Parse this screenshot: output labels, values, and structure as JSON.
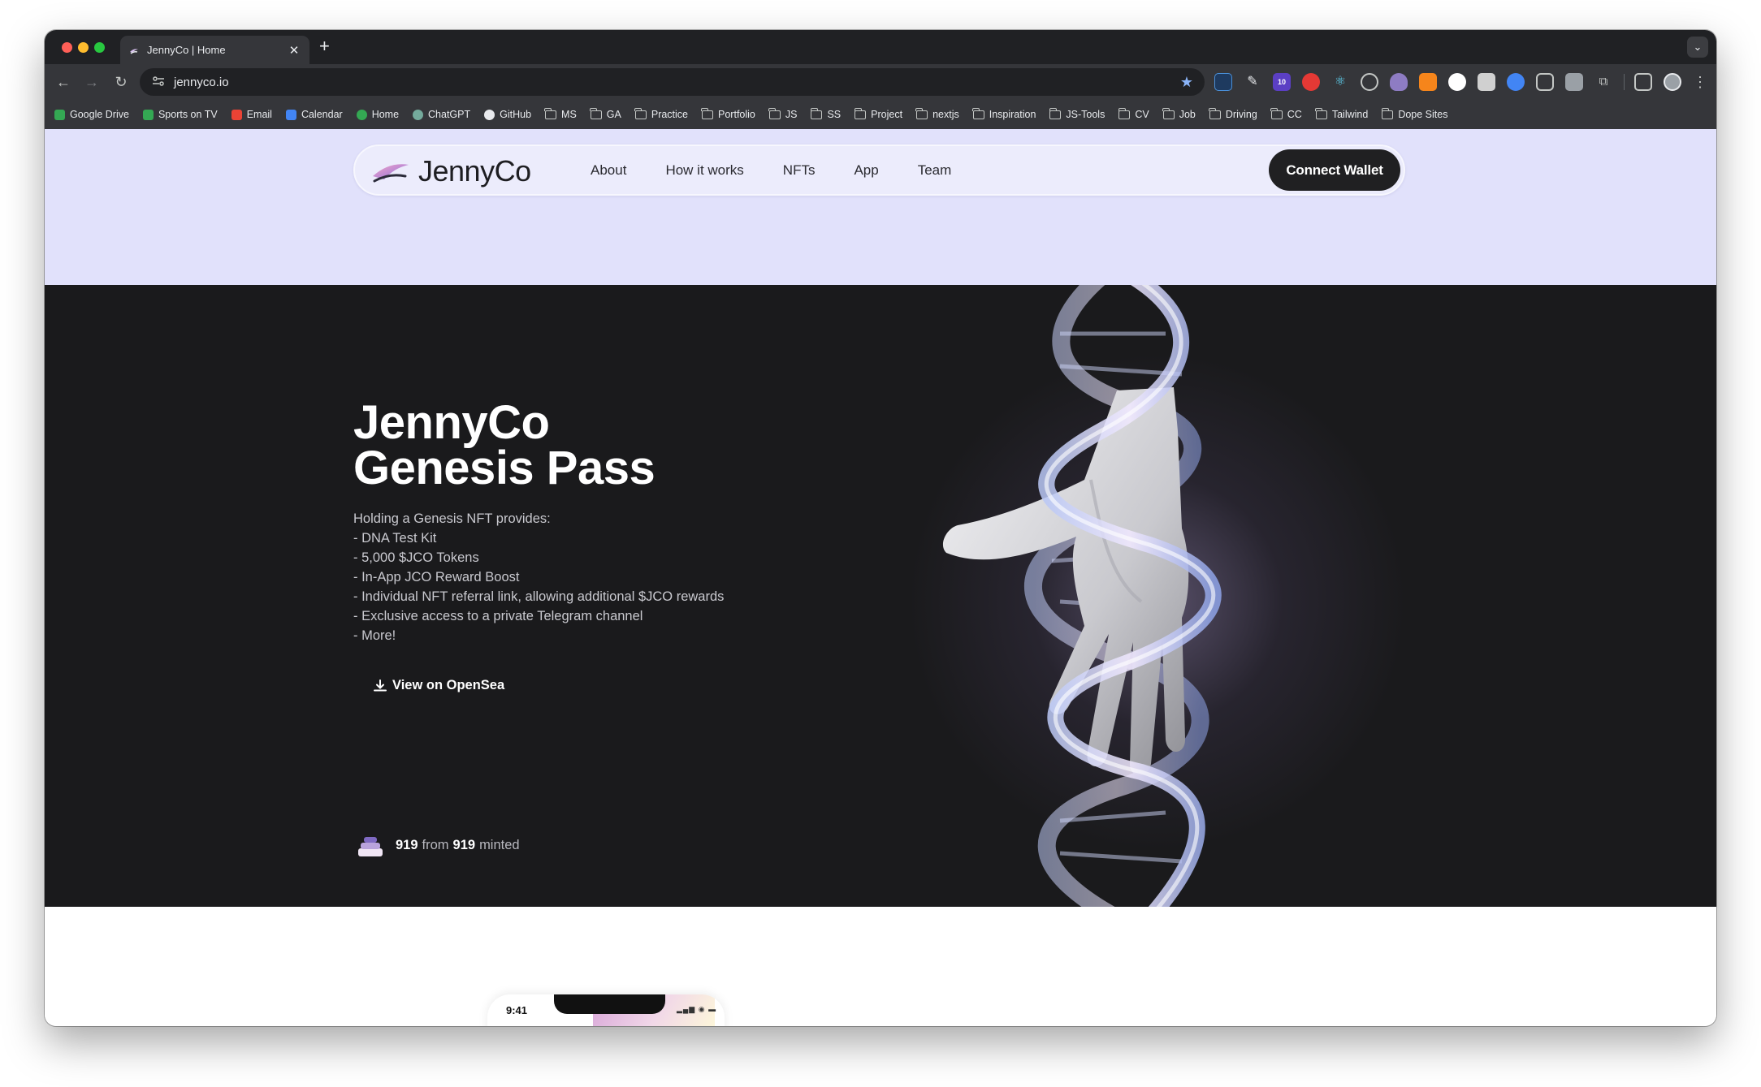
{
  "browser": {
    "tab_title": "JennyCo | Home",
    "tab_close": "✕",
    "new_tab": "+",
    "tab_menu": "⌄",
    "url": "jennyco.io",
    "extension_badge": "10",
    "bookmarks": [
      {
        "label": "Google Drive",
        "icon": "google-drive-icon",
        "color": "#34a853"
      },
      {
        "label": "Sports on TV",
        "icon": "tv-icon",
        "color": "#34a853"
      },
      {
        "label": "Email",
        "icon": "gmail-icon",
        "color": "#ea4335"
      },
      {
        "label": "Calendar",
        "icon": "calendar-icon",
        "color": "#4285f4"
      },
      {
        "label": "Home",
        "icon": "maps-pin-icon",
        "color": "#34a853"
      },
      {
        "label": "ChatGPT",
        "icon": "chatgpt-icon",
        "color": "#74aa9c"
      },
      {
        "label": "GitHub",
        "icon": "github-icon",
        "color": "#e8eaed"
      },
      {
        "label": "MS",
        "icon": "folder-icon"
      },
      {
        "label": "GA",
        "icon": "folder-icon"
      },
      {
        "label": "Practice",
        "icon": "folder-icon"
      },
      {
        "label": "Portfolio",
        "icon": "folder-icon"
      },
      {
        "label": "JS",
        "icon": "folder-icon"
      },
      {
        "label": "SS",
        "icon": "folder-icon"
      },
      {
        "label": "Project",
        "icon": "folder-icon"
      },
      {
        "label": "nextjs",
        "icon": "folder-icon"
      },
      {
        "label": "Inspiration",
        "icon": "folder-icon"
      },
      {
        "label": "JS-Tools",
        "icon": "folder-icon"
      },
      {
        "label": "CV",
        "icon": "folder-icon"
      },
      {
        "label": "Job",
        "icon": "folder-icon"
      },
      {
        "label": "Driving",
        "icon": "folder-icon"
      },
      {
        "label": "CC",
        "icon": "folder-icon"
      },
      {
        "label": "Tailwind",
        "icon": "folder-icon"
      },
      {
        "label": "Dope Sites",
        "icon": "folder-icon"
      }
    ]
  },
  "site": {
    "logo_text": "JennyCo",
    "nav": [
      {
        "label": "About"
      },
      {
        "label": "How it works"
      },
      {
        "label": "NFTs"
      },
      {
        "label": "App"
      },
      {
        "label": "Team"
      }
    ],
    "connect_wallet": "Connect Wallet",
    "hero": {
      "title_line1": "JennyCo",
      "title_line2": "Genesis Pass",
      "intro": "Holding a Genesis NFT provides:",
      "benefits": [
        "- DNA Test Kit",
        "- 5,000 $JCO Tokens",
        "- In-App JCO Reward Boost",
        "- Individual NFT referral link, allowing additional $JCO rewards",
        "- Exclusive access to a private Telegram channel",
        "- More!"
      ],
      "opensea_label": "View on OpenSea",
      "minted_count": "919",
      "minted_from": "from",
      "minted_total": "919",
      "minted_suffix": "minted"
    },
    "phone": {
      "time": "9:41"
    }
  },
  "colors": {
    "hero_bg": "#1a1a1c",
    "top_bg": "#e1e1fb",
    "accent_button": "#202022"
  }
}
